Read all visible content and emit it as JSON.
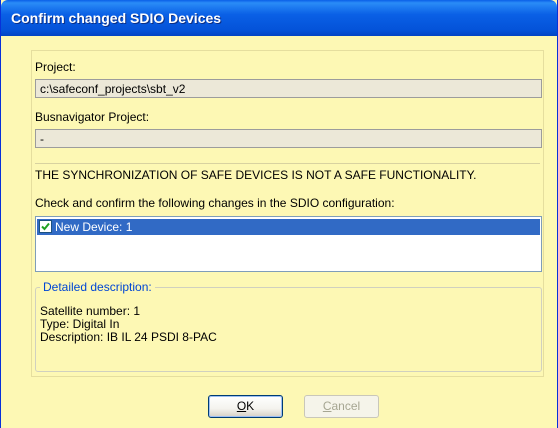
{
  "window": {
    "title": "Confirm changed SDIO Devices"
  },
  "project": {
    "label": "Project:",
    "value": "c:\\safeconf_projects\\sbt_v2"
  },
  "busnavigator": {
    "label": "Busnavigator Project:",
    "value": "-"
  },
  "warning": {
    "text": "THE SYNCHRONIZATION OF SAFE DEVICES IS NOT A SAFE FUNCTIONALITY.",
    "instruction": "Check and confirm the following changes in the SDIO configuration:"
  },
  "devices": {
    "items": [
      {
        "label": "New Device: 1",
        "checked": true,
        "selected": true
      }
    ]
  },
  "details": {
    "legend": "Detailed description:",
    "satellite": "Satellite number: 1",
    "type": "Type: Digital In",
    "description": "Description: IB IL 24 PSDI 8-PAC"
  },
  "buttons": {
    "ok_mnemonic": "O",
    "ok_rest": "K",
    "cancel_mnemonic": "C",
    "cancel_rest": "ancel"
  },
  "colors": {
    "titlebar": "#0a5fe7",
    "background": "#fdf8b4",
    "selection": "#316ac5",
    "legend": "#0046d5"
  }
}
